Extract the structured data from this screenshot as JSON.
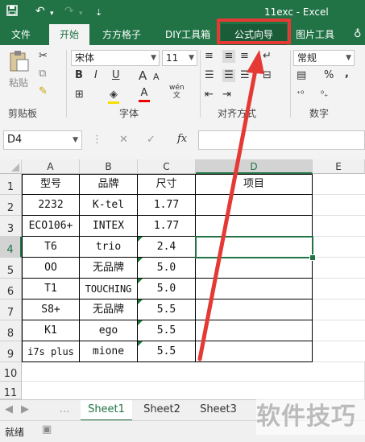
{
  "window": {
    "title": "11exc - Excel"
  },
  "tabs": [
    {
      "label": "文件"
    },
    {
      "label": "开始"
    },
    {
      "label": "方方格子"
    },
    {
      "label": "DIY工具箱"
    },
    {
      "label": "公式向导"
    },
    {
      "label": "图片工具"
    }
  ],
  "ribbon": {
    "paste_label": "粘贴",
    "clipboard_label": "剪贴板",
    "font_group_label": "字体",
    "align_group_label": "对齐方式",
    "number_group_label": "数字",
    "font_name": "宋体",
    "font_size": "11",
    "number_format": "常规",
    "bold": "B",
    "italic": "I",
    "underline": "U",
    "grow_font": "A",
    "shrink_font": "A",
    "font_color": "A",
    "wen": "wén\n文",
    "percent": "%",
    "comma": ","
  },
  "formula_bar": {
    "name_box": "D4",
    "fx": "fx",
    "value": ""
  },
  "columns": [
    "A",
    "B",
    "C",
    "D",
    "E"
  ],
  "rows": [
    "1",
    "2",
    "3",
    "4",
    "5",
    "6",
    "7",
    "8",
    "9",
    "10",
    "11"
  ],
  "table": {
    "header": [
      "型号",
      "品牌",
      "尺寸",
      "项目"
    ],
    "rows": [
      [
        "2232",
        "K-tel",
        "1.77",
        ""
      ],
      [
        "ECO106+",
        "INTEX",
        "1.77",
        ""
      ],
      [
        "T6",
        "trio",
        "2.4",
        ""
      ],
      [
        "OO",
        "无品牌",
        "5.0",
        ""
      ],
      [
        "T1",
        "TOUCHING",
        "5.0",
        ""
      ],
      [
        "S8+",
        "无品牌",
        "5.5",
        ""
      ],
      [
        "K1",
        "ego",
        "5.5",
        ""
      ],
      [
        "i7s plus",
        "mione",
        "5.5",
        ""
      ]
    ]
  },
  "sheets": [
    "Sheet1",
    "Sheet2",
    "Sheet3"
  ],
  "status": "就绪",
  "watermark": "软件技巧",
  "colors": {
    "accent": "#217346",
    "highlight": "#e53935"
  }
}
